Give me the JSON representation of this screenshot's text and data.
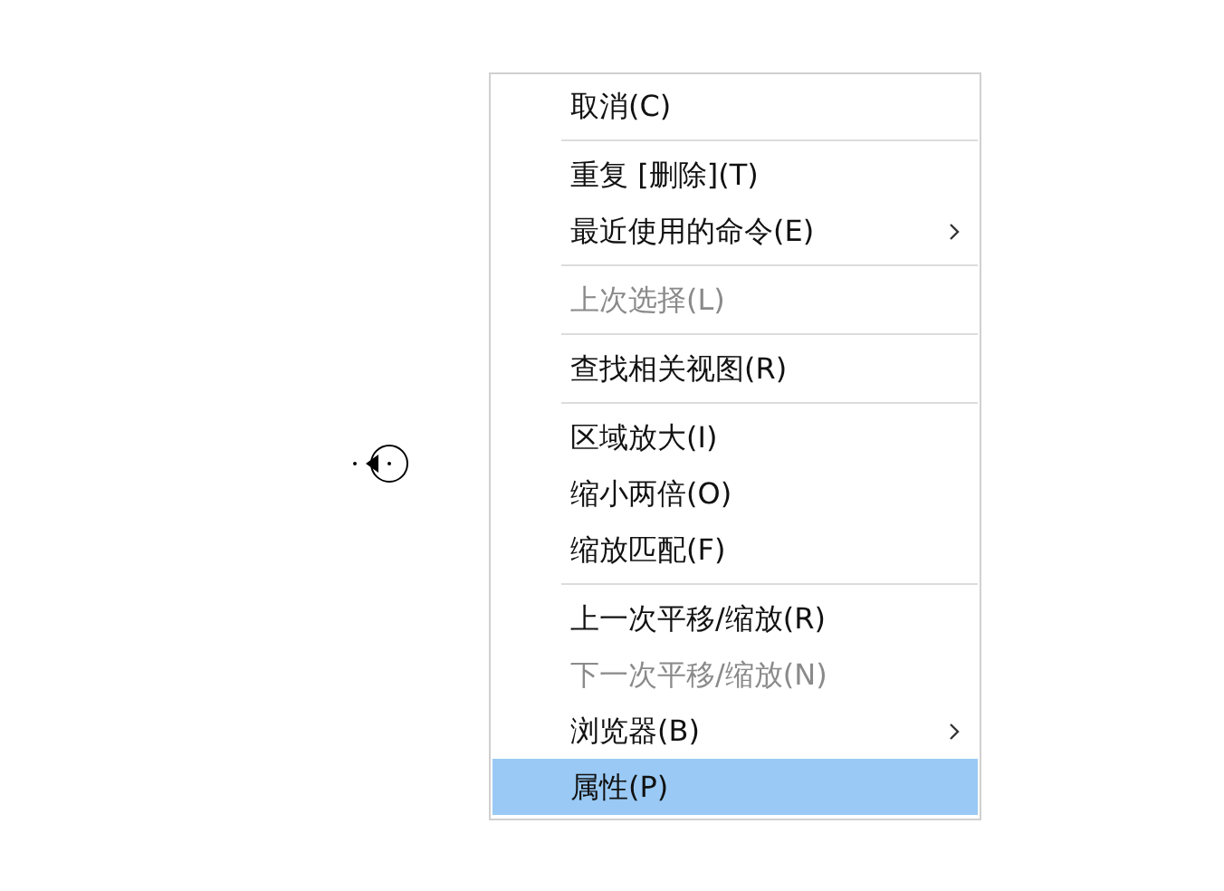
{
  "context_menu": {
    "items": [
      {
        "kind": "item",
        "label": "取消(C)",
        "disabled": false,
        "selected": false,
        "submenu": false
      },
      {
        "kind": "separator"
      },
      {
        "kind": "item",
        "label": "重复 [删除](T)",
        "disabled": false,
        "selected": false,
        "submenu": false
      },
      {
        "kind": "item",
        "label": "最近使用的命令(E)",
        "disabled": false,
        "selected": false,
        "submenu": true
      },
      {
        "kind": "separator"
      },
      {
        "kind": "item",
        "label": "上次选择(L)",
        "disabled": true,
        "selected": false,
        "submenu": false
      },
      {
        "kind": "separator"
      },
      {
        "kind": "item",
        "label": "查找相关视图(R)",
        "disabled": false,
        "selected": false,
        "submenu": false
      },
      {
        "kind": "separator"
      },
      {
        "kind": "item",
        "label": "区域放大(I)",
        "disabled": false,
        "selected": false,
        "submenu": false
      },
      {
        "kind": "item",
        "label": "缩小两倍(O)",
        "disabled": false,
        "selected": false,
        "submenu": false
      },
      {
        "kind": "item",
        "label": "缩放匹配(F)",
        "disabled": false,
        "selected": false,
        "submenu": false
      },
      {
        "kind": "separator"
      },
      {
        "kind": "item",
        "label": "上一次平移/缩放(R)",
        "disabled": false,
        "selected": false,
        "submenu": false
      },
      {
        "kind": "item",
        "label": "下一次平移/缩放(N)",
        "disabled": true,
        "selected": false,
        "submenu": false
      },
      {
        "kind": "item",
        "label": "浏览器(B)",
        "disabled": false,
        "selected": false,
        "submenu": true
      },
      {
        "kind": "item",
        "label": "属性(P)",
        "disabled": false,
        "selected": true,
        "submenu": false
      }
    ]
  }
}
